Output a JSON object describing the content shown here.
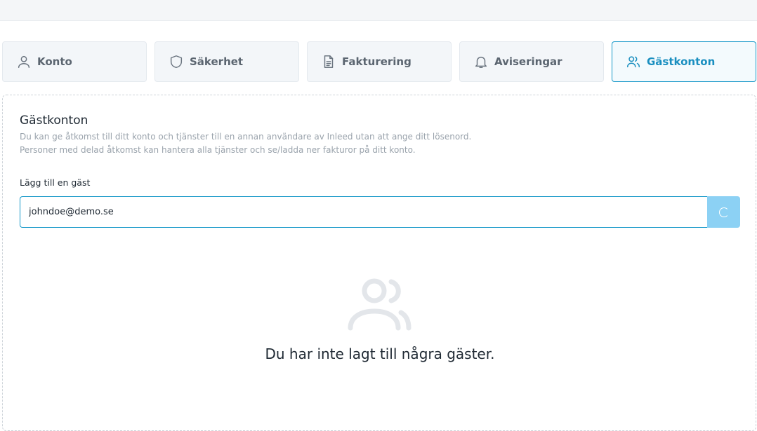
{
  "tabs": [
    {
      "label": "Konto",
      "icon": "user-icon",
      "active": false
    },
    {
      "label": "Säkerhet",
      "icon": "shield-icon",
      "active": false
    },
    {
      "label": "Fakturering",
      "icon": "document-icon",
      "active": false
    },
    {
      "label": "Aviseringar",
      "icon": "bell-icon",
      "active": false
    },
    {
      "label": "Gästkonton",
      "icon": "users-icon",
      "active": true
    }
  ],
  "panel": {
    "title": "Gästkonton",
    "description_line1": "Du kan ge åtkomst till ditt konto och tjänster till en annan användare av Inleed utan att ange ditt lösenord.",
    "description_line2": "Personer med delad åtkomst kan hantera alla tjänster och se/ladda ner fakturor på ditt konto.",
    "field_label": "Lägg till en gäst",
    "email_value": "johndoe@demo.se",
    "empty_message": "Du har inte lagt till några gäster.",
    "empty_icon": "users-icon"
  },
  "colors": {
    "accent": "#1597c8",
    "button": "#8cd1f4"
  }
}
